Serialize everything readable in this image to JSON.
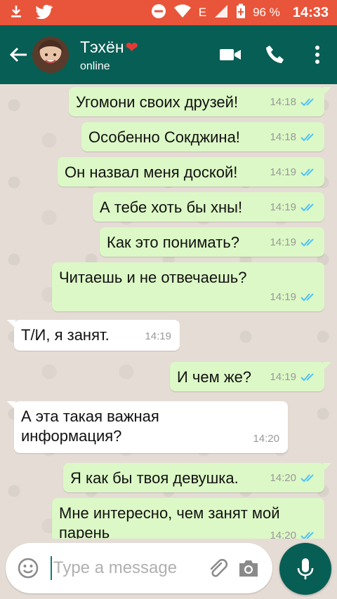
{
  "status_bar": {
    "battery": "96 %",
    "time": "14:33",
    "network": "E",
    "icons": [
      "download-icon",
      "twitter-icon",
      "do-not-disturb-icon",
      "wifi-icon",
      "signal-icon",
      "battery-icon"
    ]
  },
  "header": {
    "contact_name": "Тэхён",
    "heart": "❤",
    "status": "online"
  },
  "messages": [
    {
      "text": "Угомони своих друзей!",
      "time": "14:18",
      "direction": "outgoing"
    },
    {
      "text": "Особенно Сокджина!",
      "time": "14:18",
      "direction": "outgoing"
    },
    {
      "text": "Он назвал меня доской!",
      "time": "14:19",
      "direction": "outgoing"
    },
    {
      "text": "А тебе хоть бы хны!",
      "time": "14:19",
      "direction": "outgoing"
    },
    {
      "text": "Как это понимать?",
      "time": "14:19",
      "direction": "outgoing"
    },
    {
      "text": "Читаешь и не отвечаешь?",
      "time": "14:19",
      "direction": "outgoing"
    },
    {
      "text": "Т/И, я занят.",
      "time": "14:19",
      "direction": "incoming"
    },
    {
      "text": "И чем же?",
      "time": "14:19",
      "direction": "outgoing"
    },
    {
      "text": "А эта такая важная информация?",
      "time": "14:20",
      "direction": "incoming"
    },
    {
      "text": "Я как бы твоя девушка.",
      "time": "14:20",
      "direction": "outgoing"
    },
    {
      "text": "Мне интересно, чем занят мой парень",
      "time": "14:20",
      "direction": "outgoing"
    }
  ],
  "composer": {
    "placeholder": "Type a message"
  },
  "colors": {
    "status_bar": "#e8553a",
    "app_bar": "#075e54",
    "outgoing_bubble": "#dcf8c6",
    "incoming_bubble": "#ffffff",
    "read_ticks": "#4fc3f7"
  }
}
